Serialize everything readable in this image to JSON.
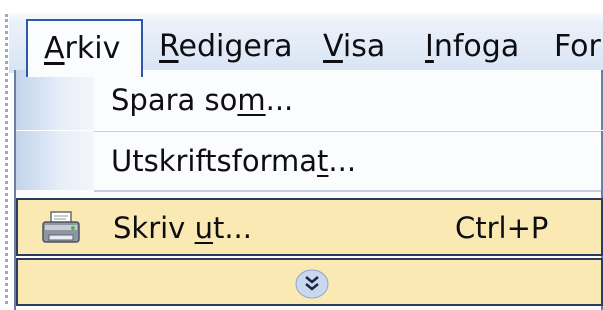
{
  "menubar": {
    "items": [
      {
        "label": "Arkiv",
        "accel": "A",
        "rest": "rkiv"
      },
      {
        "label": "Redigera",
        "accel": "R",
        "rest": "edigera"
      },
      {
        "label": "Visa",
        "accel": "V",
        "rest": "isa"
      },
      {
        "label": "Infoga",
        "accel": "I",
        "rest": "nfoga"
      },
      {
        "label": "For",
        "accel": "",
        "rest": "For"
      }
    ]
  },
  "dropdown": {
    "spara_som": {
      "before": "Spara so",
      "accel": "m",
      "after": "..."
    },
    "utskriftsformat": {
      "before": "Utskriftsforma",
      "accel": "t",
      "after": "..."
    },
    "skriv_ut": {
      "before": "Skriv ",
      "accel": "u",
      "after": "t...",
      "shortcut": "Ctrl+P"
    },
    "more": {
      "icon": "chevron-double-down-icon"
    },
    "printer_icon": "printer-icon"
  },
  "colors": {
    "highlight": "#fbe9b4",
    "highlight_border": "#2c3a5c",
    "menubar_bg": "#dde7f5",
    "active_border": "#2f59a8"
  }
}
